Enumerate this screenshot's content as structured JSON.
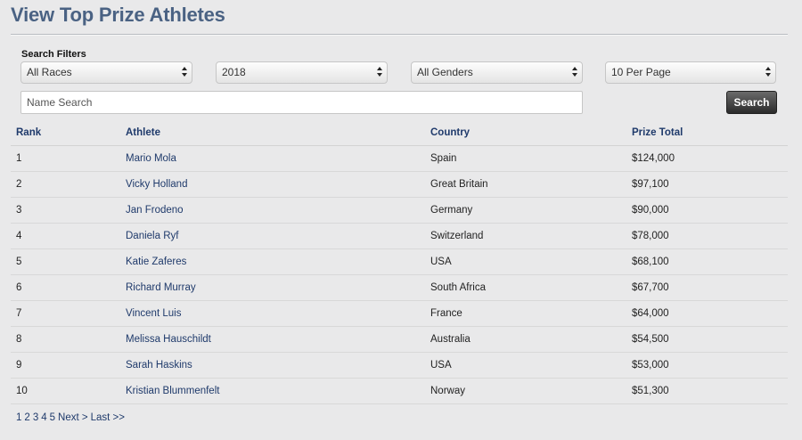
{
  "header": {
    "title": "View Top Prize Athletes"
  },
  "filters": {
    "label": "Search Filters",
    "race": "All Races",
    "year": "2018",
    "gender": "All Genders",
    "per_page": "10 Per Page",
    "name_placeholder": "Name Search",
    "search_label": "Search"
  },
  "table": {
    "columns": [
      "Rank",
      "Athlete",
      "Country",
      "Prize Total"
    ],
    "rows": [
      {
        "rank": "1",
        "athlete": "Mario Mola",
        "country": "Spain",
        "prize": "$124,000"
      },
      {
        "rank": "2",
        "athlete": "Vicky Holland",
        "country": "Great Britain",
        "prize": "$97,100"
      },
      {
        "rank": "3",
        "athlete": "Jan Frodeno",
        "country": "Germany",
        "prize": "$90,000"
      },
      {
        "rank": "4",
        "athlete": "Daniela Ryf",
        "country": "Switzerland",
        "prize": "$78,000"
      },
      {
        "rank": "5",
        "athlete": "Katie Zaferes",
        "country": "USA",
        "prize": "$68,100"
      },
      {
        "rank": "6",
        "athlete": "Richard Murray",
        "country": "South Africa",
        "prize": "$67,700"
      },
      {
        "rank": "7",
        "athlete": "Vincent Luis",
        "country": "France",
        "prize": "$64,000"
      },
      {
        "rank": "8",
        "athlete": "Melissa Hauschildt",
        "country": "Australia",
        "prize": "$54,500"
      },
      {
        "rank": "9",
        "athlete": "Sarah Haskins",
        "country": "USA",
        "prize": "$53,000"
      },
      {
        "rank": "10",
        "athlete": "Kristian Blummenfelt",
        "country": "Norway",
        "prize": "$51,300"
      }
    ]
  },
  "pagination": {
    "pages": [
      "1",
      "2",
      "3",
      "4",
      "5"
    ],
    "next": "Next >",
    "last": "Last >>"
  },
  "colors": {
    "title": "#4a6283",
    "link": "#1f3a6b",
    "background": "#e9e9ea"
  }
}
